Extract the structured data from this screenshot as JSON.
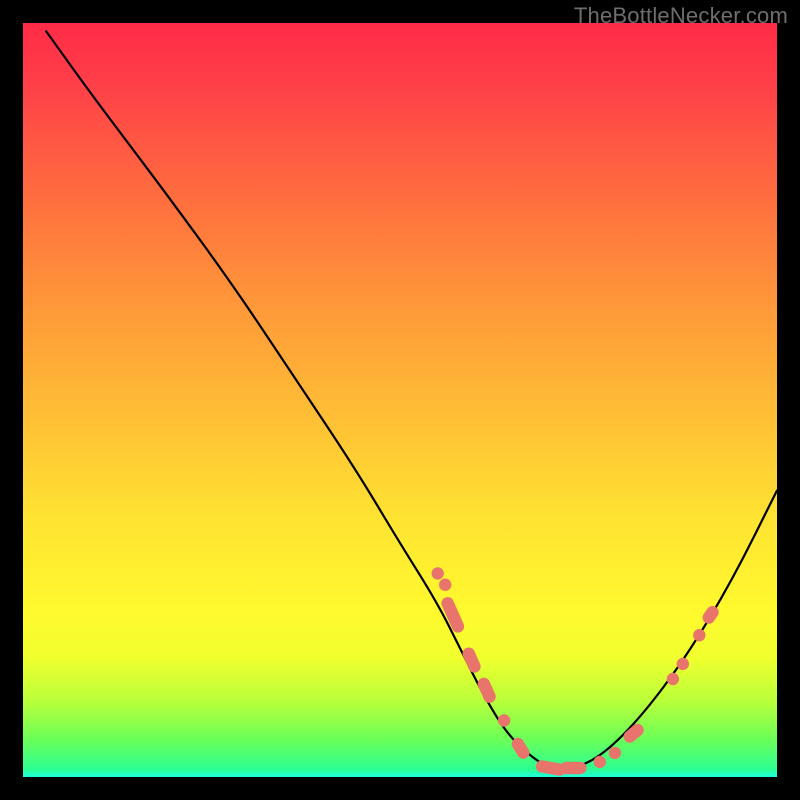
{
  "watermark": "TheBottleNecker.com",
  "colors": {
    "marker": "#e8746c",
    "line": "#000000"
  },
  "chart_data": {
    "type": "line",
    "title": "",
    "xlabel": "",
    "ylabel": "",
    "xlim": [
      0,
      100
    ],
    "ylim": [
      0,
      100
    ],
    "series": [
      {
        "name": "curve",
        "x": [
          3,
          8,
          14,
          20,
          28,
          36,
          44,
          50,
          55,
          58,
          61,
          64,
          67,
          70,
          73,
          77,
          82,
          88,
          94,
          100
        ],
        "y": [
          99,
          92,
          84,
          76,
          65,
          53,
          41,
          31,
          23,
          17,
          11,
          6,
          3,
          1,
          1,
          3,
          8,
          16,
          26,
          38
        ]
      }
    ],
    "markers": [
      {
        "shape": "dot",
        "x": 55.0,
        "y": 27.0
      },
      {
        "shape": "dot",
        "x": 56.0,
        "y": 25.5
      },
      {
        "shape": "pill",
        "x": 57.0,
        "y": 21.5,
        "len": 5.0,
        "angle": 66
      },
      {
        "shape": "pill",
        "x": 59.5,
        "y": 15.5,
        "len": 3.5,
        "angle": 66
      },
      {
        "shape": "pill",
        "x": 61.5,
        "y": 11.5,
        "len": 3.5,
        "angle": 66
      },
      {
        "shape": "dot",
        "x": 63.8,
        "y": 7.5
      },
      {
        "shape": "pill",
        "x": 66.0,
        "y": 3.8,
        "len": 3.0,
        "angle": 58
      },
      {
        "shape": "pill",
        "x": 70.0,
        "y": 1.2,
        "len": 4.0,
        "angle": 10
      },
      {
        "shape": "pill",
        "x": 73.0,
        "y": 1.2,
        "len": 3.5,
        "angle": 0
      },
      {
        "shape": "dot",
        "x": 76.5,
        "y": 2.0
      },
      {
        "shape": "dot",
        "x": 78.5,
        "y": 3.2
      },
      {
        "shape": "pill",
        "x": 81.0,
        "y": 5.8,
        "len": 3.0,
        "angle": -40
      },
      {
        "shape": "dot",
        "x": 86.2,
        "y": 13.0
      },
      {
        "shape": "dot",
        "x": 87.5,
        "y": 15.0
      },
      {
        "shape": "dot",
        "x": 89.7,
        "y": 18.8
      },
      {
        "shape": "pill",
        "x": 91.2,
        "y": 21.5,
        "len": 2.5,
        "angle": -55
      }
    ]
  }
}
